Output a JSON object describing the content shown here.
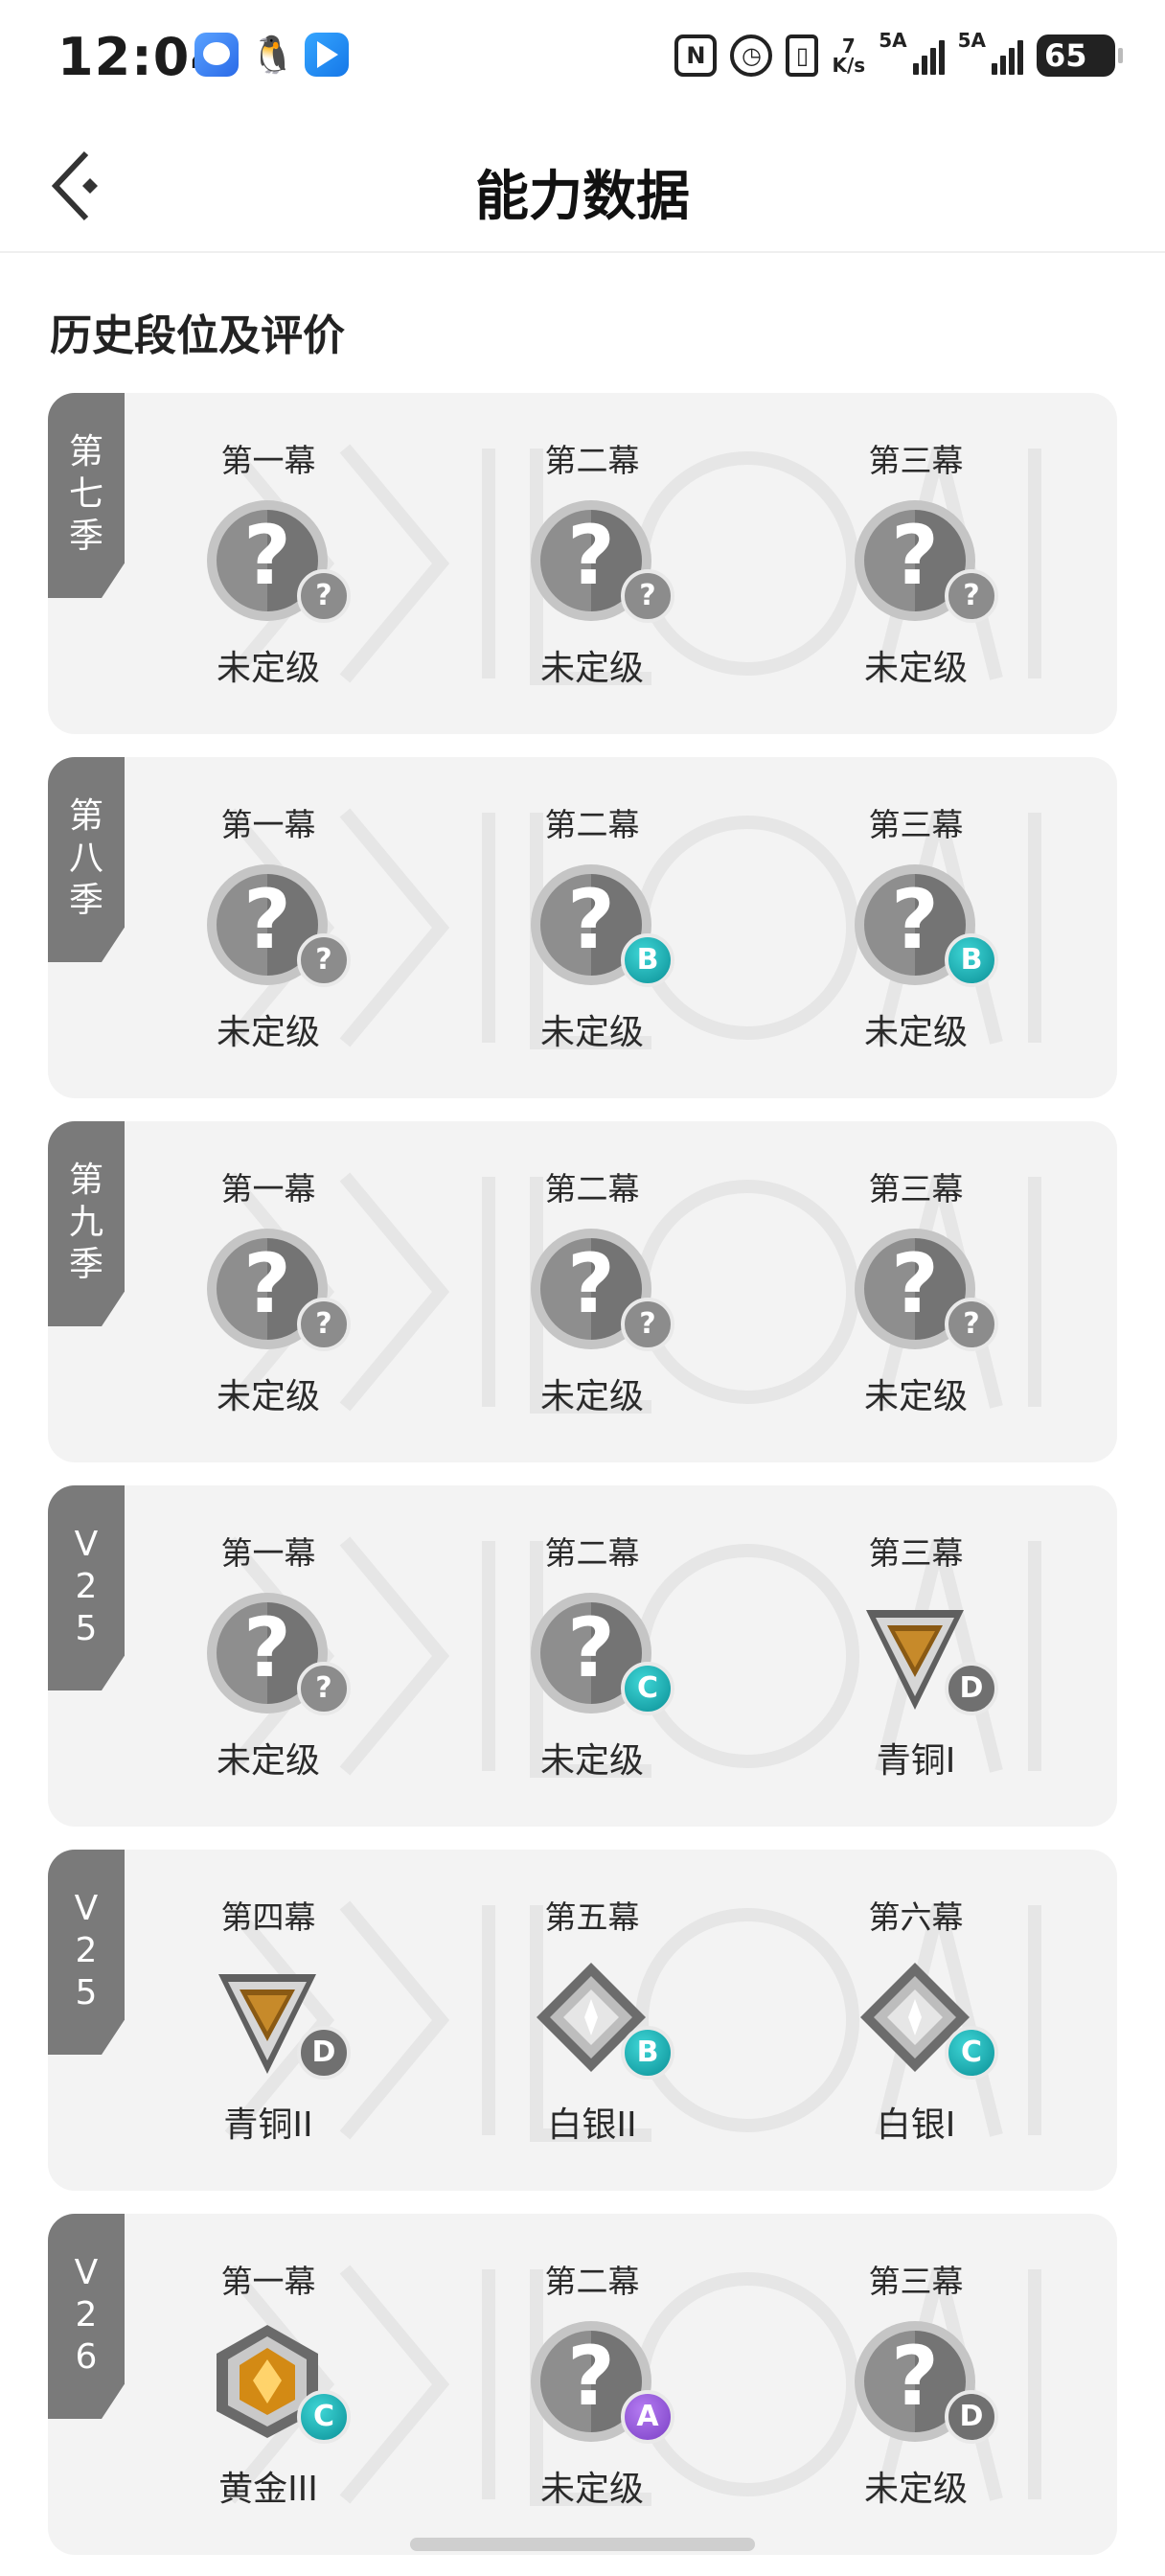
{
  "status_bar": {
    "time": "12:04",
    "net_speed_value": "7",
    "net_speed_unit": "K/s",
    "sim1": "5A",
    "sim2": "5A",
    "battery": "65",
    "icons": [
      "nfc-icon",
      "alarm-icon",
      "vibrate-icon",
      "signal-icon",
      "battery-icon"
    ]
  },
  "header": {
    "title": "能力数据",
    "back_icon": "back-chevron-icon"
  },
  "section_title": "历史段位及评价",
  "seasons": [
    {
      "tag": "第七季",
      "acts": [
        {
          "name": "第一幕",
          "rank": "未定级",
          "badge": "unranked",
          "grade": "?"
        },
        {
          "name": "第二幕",
          "rank": "未定级",
          "badge": "unranked",
          "grade": "?"
        },
        {
          "name": "第三幕",
          "rank": "未定级",
          "badge": "unranked",
          "grade": "?"
        }
      ]
    },
    {
      "tag": "第八季",
      "acts": [
        {
          "name": "第一幕",
          "rank": "未定级",
          "badge": "unranked",
          "grade": "?"
        },
        {
          "name": "第二幕",
          "rank": "未定级",
          "badge": "unranked",
          "grade": "B"
        },
        {
          "name": "第三幕",
          "rank": "未定级",
          "badge": "unranked",
          "grade": "B"
        }
      ]
    },
    {
      "tag": "第九季",
      "acts": [
        {
          "name": "第一幕",
          "rank": "未定级",
          "badge": "unranked",
          "grade": "?"
        },
        {
          "name": "第二幕",
          "rank": "未定级",
          "badge": "unranked",
          "grade": "?"
        },
        {
          "name": "第三幕",
          "rank": "未定级",
          "badge": "unranked",
          "grade": "?"
        }
      ]
    },
    {
      "tag": "V25",
      "acts": [
        {
          "name": "第一幕",
          "rank": "未定级",
          "badge": "unranked",
          "grade": "?"
        },
        {
          "name": "第二幕",
          "rank": "未定级",
          "badge": "unranked",
          "grade": "C"
        },
        {
          "name": "第三幕",
          "rank": "青铜I",
          "badge": "bronze",
          "grade": "D"
        }
      ]
    },
    {
      "tag": "V25",
      "acts": [
        {
          "name": "第四幕",
          "rank": "青铜II",
          "badge": "bronze",
          "grade": "D"
        },
        {
          "name": "第五幕",
          "rank": "白银II",
          "badge": "silver",
          "grade": "B"
        },
        {
          "name": "第六幕",
          "rank": "白银I",
          "badge": "silver",
          "grade": "C"
        }
      ]
    },
    {
      "tag": "V26",
      "acts": [
        {
          "name": "第一幕",
          "rank": "黄金III",
          "badge": "gold",
          "grade": "C"
        },
        {
          "name": "第二幕",
          "rank": "未定级",
          "badge": "unranked",
          "grade": "A"
        },
        {
          "name": "第三幕",
          "rank": "未定级",
          "badge": "unranked",
          "grade": "D"
        }
      ]
    }
  ],
  "colors": {
    "card_bg": "#f3f3f3",
    "season_tag": "#7a7a7a",
    "grade_teal": "#13a9ad",
    "grade_purple": "#9a5ddd",
    "grade_gray": "#707070"
  }
}
